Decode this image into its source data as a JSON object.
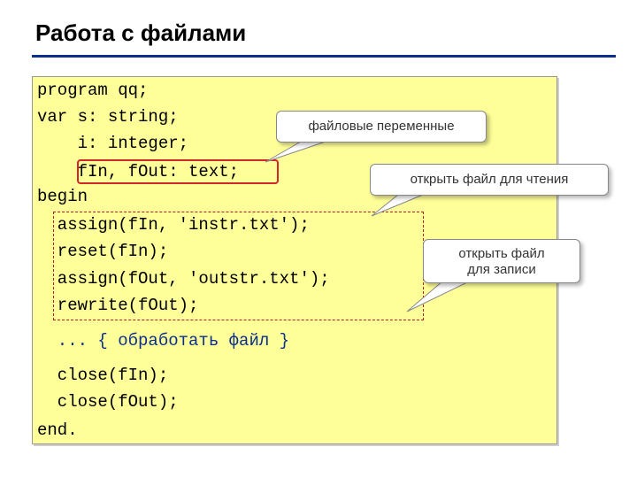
{
  "slide": {
    "title": "Работа с файлами"
  },
  "code": {
    "lines": [
      "program qq;",
      "var s: string;",
      "    i: integer;",
      "    fIn, fOut: text;",
      "begin",
      "  assign(fIn, 'instr.txt');",
      "  reset(fIn);",
      "  assign(fOut, 'outstr.txt');",
      "  rewrite(fOut);",
      "  ... { обработать файл }",
      "  close(fIn);",
      "  close(fOut);",
      "end."
    ]
  },
  "callouts": {
    "file_vars": "файловые переменные",
    "open_read": "открыть файл для чтения",
    "open_write_line1": "открыть файл",
    "open_write_line2": "для записи"
  },
  "colors": {
    "code_bg": "#ffff99",
    "title_rule": "#0b2f8c",
    "highlight": "#d0272c",
    "comment": "#0b2f8c"
  }
}
